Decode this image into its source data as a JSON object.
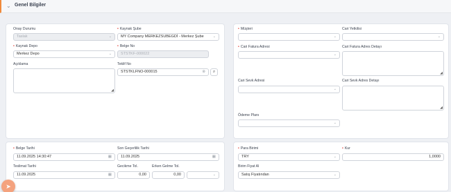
{
  "header": {
    "title": "Genel Bilgiler"
  },
  "left_top": {
    "onay_durumu": {
      "label": "Onay Durumu",
      "value": "Taslak"
    },
    "kaynak_sube": {
      "label": "Kaynak Şube",
      "value": "MY Company MERKEZSUBEGDİ - Merkez Şube"
    },
    "kaynak_depo": {
      "label": "Kaynak Depo",
      "value": "Merkez Depo"
    },
    "belge_no": {
      "label": "Belge No",
      "value": "STSTKF-000022"
    },
    "aciklama": {
      "label": "Açıklama"
    },
    "teklif_no": {
      "label": "Teklif No",
      "value": "STSTKLFNO-000015"
    }
  },
  "right_top": {
    "musteri": {
      "label": "Müşteri"
    },
    "cari_yetkilisi": {
      "label": "Cari Yetkilisi"
    },
    "cari_fatura_adresi": {
      "label": "Cari Fatura Adresi"
    },
    "cari_fatura_adres_detayi": {
      "label": "Cari Fatura Adres Detayı"
    },
    "cari_sevk_adresi": {
      "label": "Cari Sevk Adresi"
    },
    "cari_sevk_adres_detayi": {
      "label": "Cari Sevk Adres Detayı"
    },
    "odeme_plani": {
      "label": "Ödeme Planı"
    }
  },
  "left_bottom": {
    "belge_tarihi": {
      "label": "Belge Tarihi",
      "value": "11.09.2025 14:30:47"
    },
    "son_gecerlilik": {
      "label": "Son Geçerlilik Tarihi",
      "value": "11.09.2025"
    },
    "teslimat_tarihi": {
      "label": "Teslimat Tarihi",
      "value": "11.09.2025"
    },
    "gecikme_tol": {
      "label": "Gecikme Tol.",
      "value": "0,00"
    },
    "erken_gelme_tol": {
      "label": "Erken Gelme Tol.",
      "value": "0,00"
    }
  },
  "right_bottom": {
    "para_birimi": {
      "label": "Para Birimi",
      "value": "TRY"
    },
    "kur": {
      "label": "Kur",
      "value": "1,0000"
    },
    "birim_fiyat": {
      "label": "Birim Fiyat Al",
      "value": "Satış Fiyatından"
    }
  },
  "icons": [
    "chevron-down-icon",
    "calendar-icon",
    "search-icon",
    "clear-icon",
    "send-icon"
  ]
}
